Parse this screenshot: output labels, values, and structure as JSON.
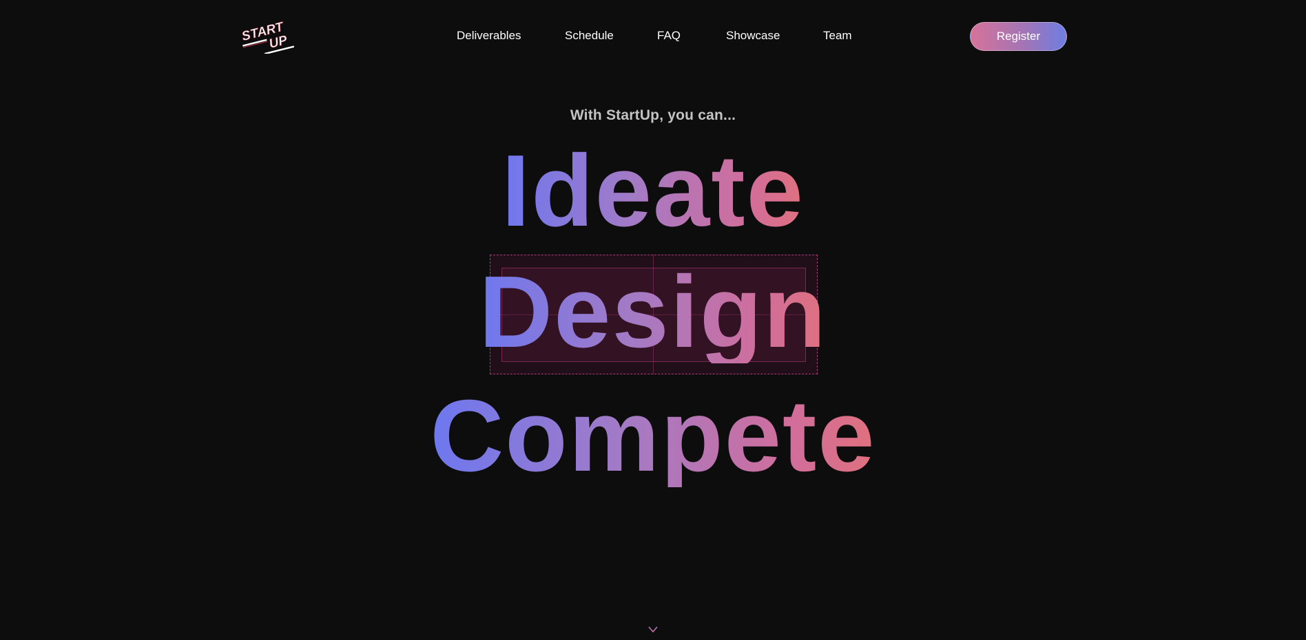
{
  "logo": {
    "line1": "START",
    "line2": "UP"
  },
  "nav": {
    "items": [
      {
        "label": "Deliverables"
      },
      {
        "label": "Schedule"
      },
      {
        "label": "FAQ"
      },
      {
        "label": "Showcase"
      },
      {
        "label": "Team"
      }
    ]
  },
  "header": {
    "register_label": "Register"
  },
  "hero": {
    "subtitle": "With StartUp, you can...",
    "words": [
      "Ideate",
      "Design",
      "Compete"
    ]
  },
  "colors": {
    "background": "#0d0d0d",
    "gradient_start": "#6c78f0",
    "gradient_end": "#e0707c",
    "selection_outline": "#b03a78"
  },
  "icons": {
    "scroll": "arrow-down-icon"
  }
}
